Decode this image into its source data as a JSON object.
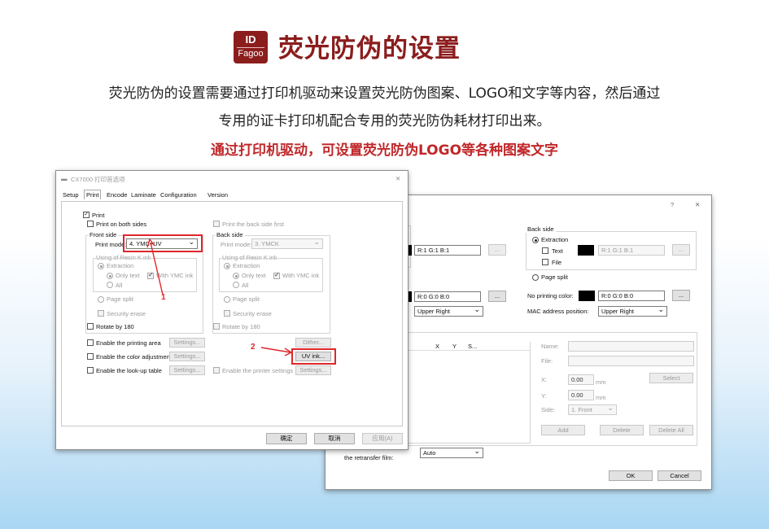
{
  "header": {
    "logo_top": "ID",
    "logo_bottom": "Fagoo",
    "title": "荧光防伪的设置"
  },
  "intro": {
    "line1": "荧光防伪的设置需要通过打印机驱动来设置荧光防伪图案、LOGO和文字等内容，然后通过",
    "line2": "专用的证卡打印机配合专用的荧光防伪耗材打印出来。",
    "highlight": "通过打印机驱动，可设置荧光防伪LOGO等各种图案文字"
  },
  "back_dialog": {
    "help": "?",
    "close": "✕",
    "back_side_label": "Back side",
    "extraction": "Extraction",
    "text": "Text",
    "file": "File",
    "page_split": "Page split",
    "rgb_left_top": "R:1 G:1 B:1",
    "rgb_right_top": "R:1 G:1 B:1",
    "rgb_left_mid": "R:0 G:0 B:0",
    "rgb_right_mid": "R:0 G:0 B:0",
    "no_printing_color": "No printing color:",
    "mac_address_position": "MAC address position:",
    "position_left": "Upper Right",
    "position_right": "Upper Right",
    "ellipsis": "...",
    "cols": [
      "X",
      "Y",
      "S..."
    ],
    "name": "Name:",
    "file_field": "File:",
    "x": "X:",
    "y": "Y:",
    "side": "Side:",
    "x_val": "0.00",
    "y_val": "0.00",
    "mm": "mm",
    "side_val": "1. Front",
    "select": "Select",
    "add": "Add",
    "delete": "Delete",
    "delete_all": "Delete All",
    "retransfer": "the retransfer film:",
    "retransfer_val": "Auto",
    "ok": "OK",
    "cancel": "Cancel"
  },
  "front_dialog": {
    "title": "CX7000 打印首选项",
    "close": "✕",
    "tabs": [
      "Setup",
      "Print",
      "Encode",
      "Laminate",
      "Configuration",
      "Version"
    ],
    "print": "Print",
    "print_both": "Print on both sides",
    "print_back_first": "Print the back side first",
    "front_side": "Front side",
    "back_side": "Back side",
    "print_mode": "Print mode:",
    "front_mode": "4. YMC+UV",
    "back_mode": "3. YMCK",
    "resin": "Using of Resin K ink",
    "extraction": "Extraction",
    "only_text": "Only text",
    "with_ymc": "With YMC ink",
    "all": "All",
    "page_split": "Page split",
    "security_erase": "Security erase",
    "rotate": "Rotate by 180",
    "enable_area": "Enable the printing area",
    "enable_color": "Enable the color adjustment",
    "enable_lookup": "Enable the look-up table",
    "enable_printer": "Enable the printer settings",
    "settings": "Settings...",
    "dither": "Dither...",
    "uv_ink": "UV ink...",
    "ok": "确定",
    "cancel": "取消",
    "apply": "应用(A)",
    "marker1": "1",
    "marker2": "2"
  }
}
